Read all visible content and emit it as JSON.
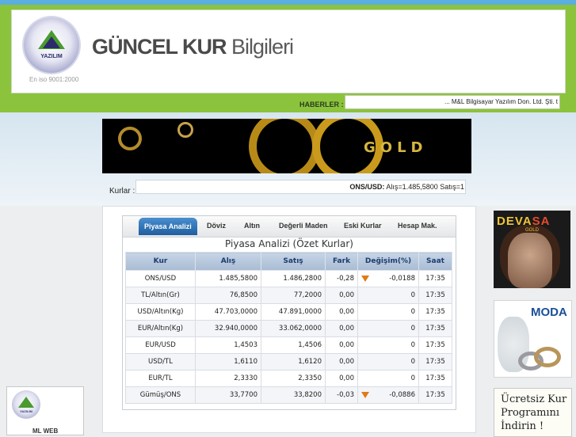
{
  "header": {
    "title_bold": "GÜNCEL KUR",
    "title_light": "Bilgileri",
    "logo_text": "YAZILIM",
    "iso_text": "En iso 9001:2000"
  },
  "news": {
    "label": "HABERLER :",
    "ticker": "... M&L Bilgisayar Yazılım Don. Ltd. Şti. t"
  },
  "banner": {
    "text": "GOLD"
  },
  "kurlar": {
    "label": "Kurlar :",
    "ticker_pair": "ONS/USD:",
    "ticker_values": " Alış=1.485,5800 Satış=1"
  },
  "widget": {
    "tabs": [
      {
        "label": "Piyasa Analizi",
        "active": true
      },
      {
        "label": "Döviz"
      },
      {
        "label": "Altın"
      },
      {
        "label": "Değerli Maden"
      },
      {
        "label": "Eski Kurlar"
      },
      {
        "label": "Hesap Mak."
      }
    ],
    "title": "Piyasa Analizi (Özet Kurlar)",
    "columns": [
      "Kur",
      "Alış",
      "Satış",
      "Fark",
      "Değişim(%)",
      "Saat"
    ],
    "rows": [
      {
        "kur": "ONS/USD",
        "alis": "1.485,5800",
        "satis": "1.486,2800",
        "fark": "-0,28",
        "degisim": "-0,0188",
        "saat": "17:35",
        "arrow": "down"
      },
      {
        "kur": "TL/Altın(Gr)",
        "alis": "76,8500",
        "satis": "77,2000",
        "fark": "0,00",
        "degisim": "0",
        "saat": "17:35"
      },
      {
        "kur": "USD/Altın(Kg)",
        "alis": "47.703,0000",
        "satis": "47.891,0000",
        "fark": "0,00",
        "degisim": "0",
        "saat": "17:35"
      },
      {
        "kur": "EUR/Altın(Kg)",
        "alis": "32.940,0000",
        "satis": "33.062,0000",
        "fark": "0,00",
        "degisim": "0",
        "saat": "17:35"
      },
      {
        "kur": "EUR/USD",
        "alis": "1,4503",
        "satis": "1,4506",
        "fark": "0,00",
        "degisim": "0",
        "saat": "17:35"
      },
      {
        "kur": "USD/TL",
        "alis": "1,6110",
        "satis": "1,6120",
        "fark": "0,00",
        "degisim": "0",
        "saat": "17:35"
      },
      {
        "kur": "EUR/TL",
        "alis": "2,3330",
        "satis": "2,3350",
        "fark": "0,00",
        "degisim": "0",
        "saat": "17:35"
      },
      {
        "kur": "Gümüş/ONS",
        "alis": "33,7700",
        "satis": "33,8200",
        "fark": "-0,03",
        "degisim": "-0,0886",
        "saat": "17:35",
        "arrow": "down"
      }
    ]
  },
  "ads": {
    "devasa_title_1": "DEVA",
    "devasa_title_2": "SA",
    "devasa_sub": "GOLD",
    "moda_title": "MODA",
    "program_text": "Ücretsiz Kur Programını İndirin !",
    "left_logo_text": "YAZILIM",
    "left_sub": "ML WEB"
  },
  "colors": {
    "green_band": "#8bc33c",
    "tab_active": "#2a6cb0",
    "arrow_down": "#e07a18"
  }
}
